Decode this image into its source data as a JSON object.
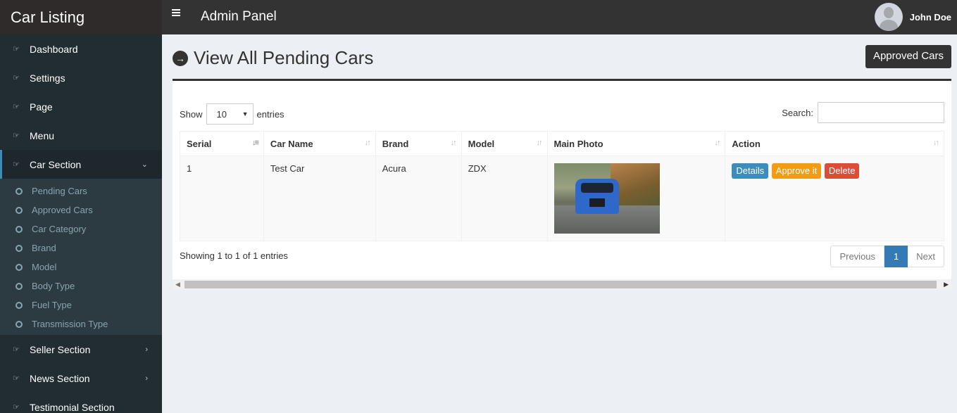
{
  "brand": "Car Listing",
  "header": {
    "title": "Admin Panel",
    "user_name": "John Doe"
  },
  "sidebar": {
    "items": [
      {
        "label": "Dashboard"
      },
      {
        "label": "Settings"
      },
      {
        "label": "Page"
      },
      {
        "label": "Menu"
      },
      {
        "label": "Car Section"
      }
    ],
    "car_submenu": [
      "Pending Cars",
      "Approved Cars",
      "Car Category",
      "Brand",
      "Model",
      "Body Type",
      "Fuel Type",
      "Transmission Type"
    ],
    "more_items": [
      {
        "label": "Seller Section"
      },
      {
        "label": "News Section"
      },
      {
        "label": "Testimonial Section"
      }
    ]
  },
  "page": {
    "title": "View All Pending Cars",
    "approved_button": "Approved Cars"
  },
  "table_controls": {
    "show_label": "Show",
    "entries_value": "10",
    "entries_label": "entries",
    "search_label": "Search:",
    "search_placeholder": ""
  },
  "table": {
    "columns": [
      "Serial",
      "Car Name",
      "Brand",
      "Model",
      "Main Photo",
      "Action"
    ],
    "rows": [
      {
        "serial": "1",
        "car_name": "Test Car",
        "brand": "Acura",
        "model": "ZDX"
      }
    ],
    "actions": {
      "details": "Details",
      "approve": "Approve it",
      "delete": "Delete"
    }
  },
  "footer": {
    "info": "Showing 1 to 1 of 1 entries",
    "previous": "Previous",
    "current_page": "1",
    "next": "Next"
  },
  "colors": {
    "primary": "#3c8dbc",
    "warning": "#f39c12",
    "danger": "#dd4b39",
    "sidebar": "#222d32"
  }
}
